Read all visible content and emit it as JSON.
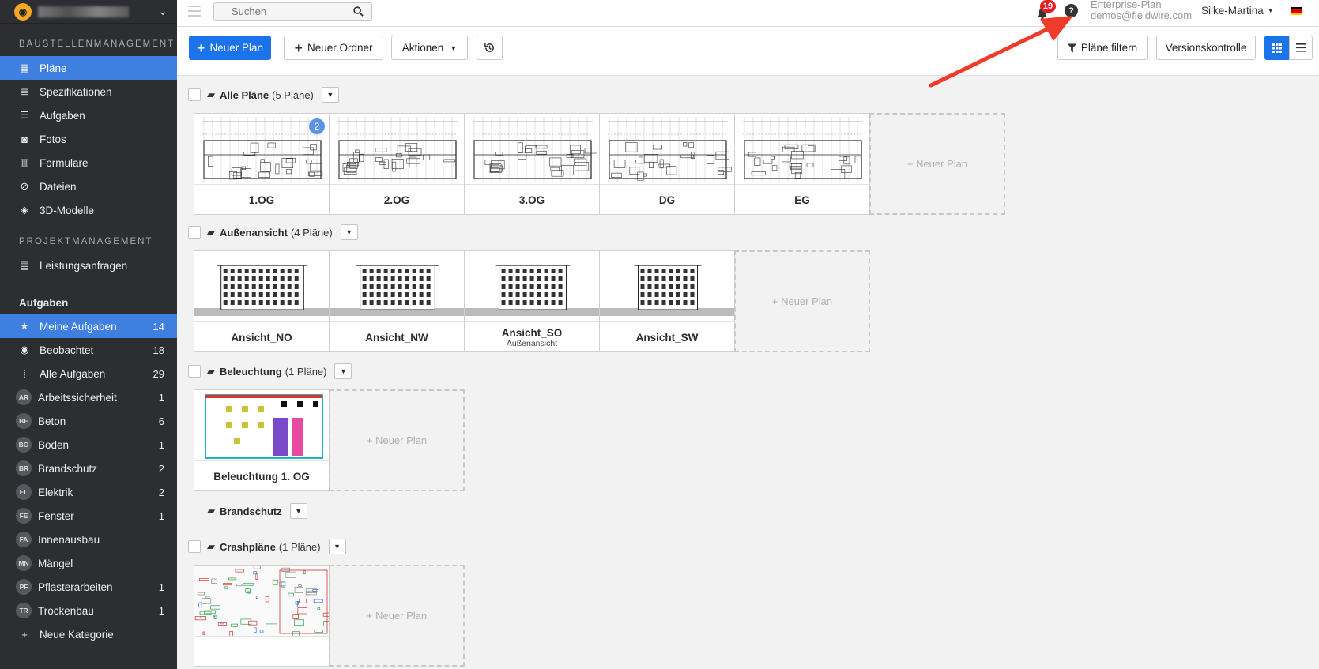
{
  "sidebar": {
    "section1": "BAUSTELLENMANAGEMENT",
    "nav1": [
      {
        "label": "Pläne",
        "icon": "plans-icon"
      },
      {
        "label": "Spezifikationen",
        "icon": "specs-icon"
      },
      {
        "label": "Aufgaben",
        "icon": "list-icon"
      },
      {
        "label": "Fotos",
        "icon": "camera-icon"
      },
      {
        "label": "Formulare",
        "icon": "form-icon"
      },
      {
        "label": "Dateien",
        "icon": "paperclip-icon"
      },
      {
        "label": "3D-Modelle",
        "icon": "cube-icon"
      }
    ],
    "section2": "PROJEKTMANAGEMENT",
    "nav2": [
      {
        "label": "Leistungsanfragen",
        "icon": "document-icon"
      }
    ],
    "tasks_heading": "Aufgaben",
    "tasks": [
      {
        "label": "Meine Aufgaben",
        "count": "14",
        "icon": "star-icon"
      },
      {
        "label": "Beobachtet",
        "count": "18",
        "icon": "eye-icon"
      },
      {
        "label": "Alle Aufgaben",
        "count": "29",
        "icon": "grid-icon"
      }
    ],
    "categories": [
      {
        "abbr": "AR",
        "label": "Arbeitssicherheit",
        "count": "1"
      },
      {
        "abbr": "BE",
        "label": "Beton",
        "count": "6"
      },
      {
        "abbr": "BO",
        "label": "Boden",
        "count": "1"
      },
      {
        "abbr": "BR",
        "label": "Brandschutz",
        "count": "2"
      },
      {
        "abbr": "EL",
        "label": "Elektrik",
        "count": "2"
      },
      {
        "abbr": "FE",
        "label": "Fenster",
        "count": "1"
      },
      {
        "abbr": "FA",
        "label": "Innenausbau",
        "count": ""
      },
      {
        "abbr": "MN",
        "label": "Mängel",
        "count": ""
      },
      {
        "abbr": "PF",
        "label": "Pflasterarbeiten",
        "count": "1"
      },
      {
        "abbr": "TR",
        "label": "Trockenbau",
        "count": "1"
      }
    ],
    "new_category": "Neue Kategorie"
  },
  "topbar": {
    "search_placeholder": "Suchen",
    "notification_count": "19",
    "plan_name": "Enterprise-Plan",
    "email": "demos@fieldwire.com",
    "user_name": "Silke-Martina"
  },
  "toolbar": {
    "new_plan": "Neuer Plan",
    "new_folder": "Neuer Ordner",
    "actions": "Aktionen",
    "filter": "Pläne filtern",
    "version_control": "Versionskontrolle"
  },
  "folders": [
    {
      "name": "Alle Pläne",
      "count": "(5 Pläne)",
      "plans": [
        {
          "name": "1.OG",
          "sub": "",
          "badge": "2",
          "kind": "floor"
        },
        {
          "name": "2.OG",
          "sub": "",
          "badge": "",
          "kind": "floor"
        },
        {
          "name": "3.OG",
          "sub": "",
          "badge": "",
          "kind": "floor"
        },
        {
          "name": "DG",
          "sub": "",
          "badge": "",
          "kind": "floor"
        },
        {
          "name": "EG",
          "sub": "",
          "badge": "",
          "kind": "floor"
        }
      ]
    },
    {
      "name": "Außenansicht",
      "count": "(4 Pläne)",
      "plans": [
        {
          "name": "Ansicht_NO",
          "sub": "",
          "badge": "",
          "kind": "elev"
        },
        {
          "name": "Ansicht_NW",
          "sub": "",
          "badge": "",
          "kind": "elev"
        },
        {
          "name": "Ansicht_SO",
          "sub": "Außenansicht",
          "badge": "",
          "kind": "elev"
        },
        {
          "name": "Ansicht_SW",
          "sub": "",
          "badge": "",
          "kind": "elev"
        }
      ]
    },
    {
      "name": "Beleuchtung",
      "count": "(1 Pläne)",
      "plans": [
        {
          "name": "Beleuchtung 1. OG",
          "sub": "",
          "badge": "",
          "kind": "light"
        }
      ]
    },
    {
      "name": "Brandschutz",
      "count": "",
      "plans": []
    },
    {
      "name": "Crashpläne",
      "count": "(1 Pläne)",
      "plans": [
        {
          "name": "",
          "sub": "",
          "badge": "",
          "kind": "crash"
        }
      ]
    }
  ],
  "new_plan_tile": "+ Neuer Plan",
  "colors": {
    "accent": "#1a73e8",
    "sidebar": "#2c2e31",
    "active_nav": "#3f7fe0",
    "notification": "#e02020",
    "arrow": "#f03a2a"
  }
}
